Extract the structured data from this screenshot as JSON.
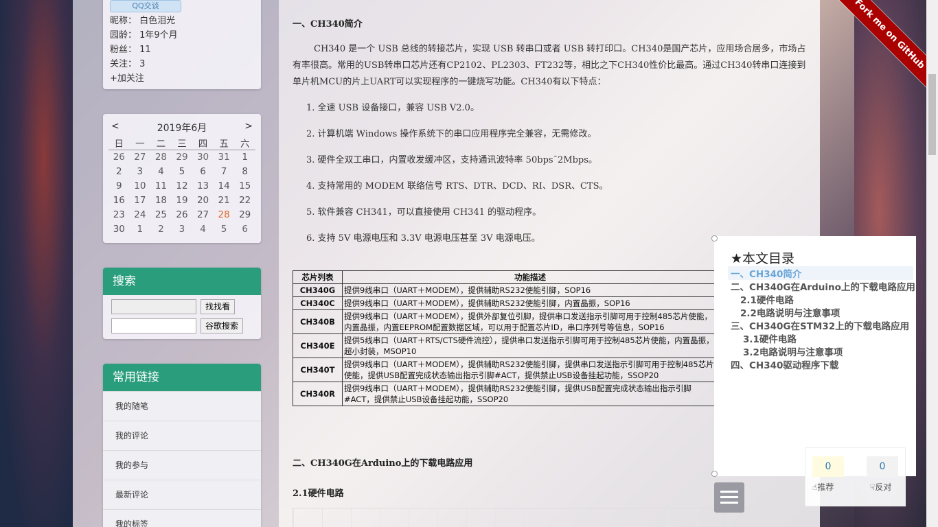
{
  "profile": {
    "qq_label": "QQ交谈",
    "nickname": "昵称：  白色泪光",
    "age": "园龄：  1年9个月",
    "fans": "粉丝：  11",
    "follow": "关注：  3",
    "add_follow": "+加关注"
  },
  "calendar": {
    "prev": "<",
    "title": "2019年6月",
    "next": ">",
    "weekdays": [
      "日",
      "一",
      "二",
      "三",
      "四",
      "五",
      "六"
    ],
    "weeks": [
      [
        "26",
        "27",
        "28",
        "29",
        "30",
        "31",
        "1"
      ],
      [
        "2",
        "3",
        "4",
        "5",
        "6",
        "7",
        "8"
      ],
      [
        "9",
        "10",
        "11",
        "12",
        "13",
        "14",
        "15"
      ],
      [
        "16",
        "17",
        "18",
        "19",
        "20",
        "21",
        "22"
      ],
      [
        "23",
        "24",
        "25",
        "26",
        "27",
        "28",
        "29"
      ],
      [
        "30",
        "1",
        "2",
        "3",
        "4",
        "5",
        "6"
      ]
    ],
    "today": "28"
  },
  "search": {
    "title": "搜索",
    "btn1": "找找看",
    "btn2": "谷歌搜索"
  },
  "links": {
    "title": "常用链接",
    "items": [
      "我的随笔",
      "我的评论",
      "我的参与",
      "最新评论",
      "我的标签"
    ]
  },
  "article": {
    "h_intro": "一、CH340简介",
    "intro": "CH340 是一个 USB 总线的转接芯片，实现 USB 转串口或者 USB 转打印口。CH340是国产芯片，应用场合居多，市场占有率很高。常用的USB转串口芯片还有CP2102、PL2303、FT232等，相比之下CH340性价比最高。通过CH340转串口连接到单片机MCU的片上UART可以实现程序的一键烧写功能。CH340有以下特点：",
    "features": [
      "1. 全速 USB 设备接口，兼容 USB V2.0。",
      "2. 计算机端 Windows 操作系统下的串口应用程序完全兼容，无需修改。",
      "3. 硬件全双工串口，内置收发缓冲区，支持通讯波特率 50bps¯2Mbps。",
      "4. 支持常用的 MODEM 联络信号 RTS、DTR、DCD、RI、DSR、CTS。",
      "5. 软件兼容 CH341，可以直接使用 CH341 的驱动程序。",
      "6. 支持 5V 电源电压和 3.3V 电源电压甚至 3V 电源电压。"
    ],
    "table_headers": [
      "芯片列表",
      "功能描述"
    ],
    "table_rows": [
      {
        "name": "CH340G",
        "desc": "提供9线串口（UART＋MODEM），提供辅助RS232使能引脚，SOP16"
      },
      {
        "name": "CH340C",
        "desc": "提供9线串口（UART＋MODEM），提供辅助RS232使能引脚，内置晶振，SOP16"
      },
      {
        "name": "CH340B",
        "desc": "提供9线串口（UART＋MODEM），提供外部复位引脚，提供串口发送指示引脚可用于控制485芯片使能，内置晶振，内置EEPROM配置数据区域，可以用于配置芯片ID，串口序列号等信息，SOP16"
      },
      {
        "name": "CH340E",
        "desc": "提供5线串口（UART＋RTS/CTS硬件流控），提供串口发送指示引脚可用于控制485芯片使能，内置晶振，超小封装，MSOP10"
      },
      {
        "name": "CH340T",
        "desc": "提供9线串口（UART＋MODEM），提供辅助RS232使能引脚，提供串口发送指示引脚可用于控制485芯片使能，提供USB配置完成状态输出指示引脚#ACT，提供禁止USB设备挂起功能，SSOP20"
      },
      {
        "name": "CH340R",
        "desc": "提供9线串口（UART＋MODEM），提供辅助RS232使能引脚，提供USB配置完成状态输出指示引脚#ACT，提供禁止USB设备挂起功能，SSOP20"
      }
    ],
    "h_arduino": "二、CH340G在Arduino上的下载电路应用",
    "h_hw": "2.1硬件电路"
  },
  "ribbon": "Fork me on GitHub",
  "toc": {
    "title": "★本文目录",
    "items": [
      "一、CH340简介",
      "二、CH340G在Arduino上的下载电路应用",
      "2.1硬件电路",
      "2.2电路说明与注意事项",
      "三、CH340G在STM32上的下载电路应用",
      "3.1硬件电路",
      "3.2电路说明与注意事项",
      "四、CH340驱动程序下载"
    ]
  },
  "vote": {
    "up_count": "0",
    "down_count": "0",
    "up_label": "推荐",
    "down_label": "反对"
  }
}
